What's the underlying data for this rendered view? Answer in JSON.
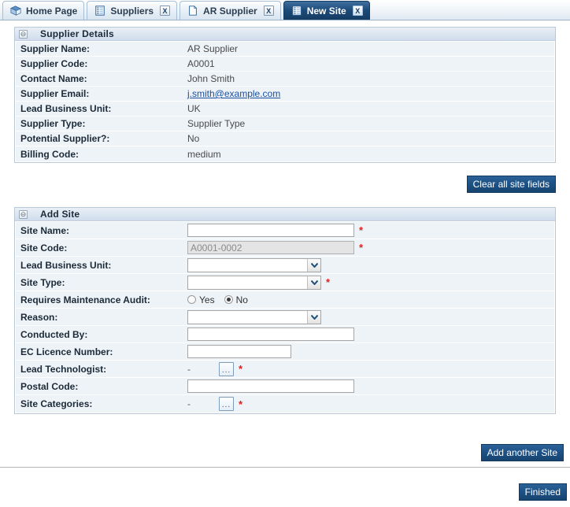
{
  "tabs": [
    {
      "label": "Home Page",
      "icon": "book-icon",
      "closable": false,
      "active": false
    },
    {
      "label": "Suppliers",
      "icon": "grid-icon",
      "closable": true,
      "active": false,
      "close_label": "X"
    },
    {
      "label": "AR Supplier",
      "icon": "page-icon",
      "closable": true,
      "active": false,
      "close_label": "X"
    },
    {
      "label": "New Site",
      "icon": "grid-icon",
      "closable": true,
      "active": true,
      "close_label": "X"
    }
  ],
  "supplier_details": {
    "title": "Supplier Details",
    "collapse_glyph": "⊖",
    "rows": [
      {
        "label": "Supplier Name:",
        "value": "AR Supplier",
        "type": "text"
      },
      {
        "label": "Supplier Code:",
        "value": "A0001",
        "type": "text"
      },
      {
        "label": "Contact Name:",
        "value": "John Smith",
        "type": "text"
      },
      {
        "label": "Supplier Email:",
        "value": "j.smith@example.com",
        "type": "link"
      },
      {
        "label": "Lead Business Unit:",
        "value": "UK",
        "type": "text"
      },
      {
        "label": "Supplier Type:",
        "value": "Supplier Type",
        "type": "text"
      },
      {
        "label": "Potential Supplier?:",
        "value": "No",
        "type": "text"
      },
      {
        "label": "Billing Code:",
        "value": "medium",
        "type": "text"
      }
    ]
  },
  "clear_button": {
    "label": "Clear all site fields"
  },
  "add_site": {
    "title": "Add Site",
    "collapse_glyph": "⊖",
    "site_name": {
      "label": "Site Name:",
      "value": "",
      "required": "*"
    },
    "site_code": {
      "label": "Site Code:",
      "value": "A0001-0002",
      "required": "*",
      "disabled": true
    },
    "lead_business_unit": {
      "label": "Lead Business Unit:",
      "value": ""
    },
    "site_type": {
      "label": "Site Type:",
      "value": "",
      "required": "*"
    },
    "maintenance_audit": {
      "label": "Requires Maintenance Audit:",
      "options": [
        {
          "label": "Yes",
          "selected": false
        },
        {
          "label": "No",
          "selected": true
        }
      ]
    },
    "reason": {
      "label": "Reason:",
      "value": ""
    },
    "conducted_by": {
      "label": "Conducted By:",
      "value": ""
    },
    "ec_licence": {
      "label": "EC Licence Number:",
      "value": ""
    },
    "lead_technologist": {
      "label": "Lead Technologist:",
      "value": "-",
      "picker": "...",
      "required": "*"
    },
    "postal_code": {
      "label": "Postal Code:",
      "value": ""
    },
    "site_categories": {
      "label": "Site Categories:",
      "value": "-",
      "picker": "...",
      "required": "*"
    }
  },
  "add_another_button": {
    "label": "Add another Site"
  },
  "finished_button": {
    "label": "Finished"
  }
}
